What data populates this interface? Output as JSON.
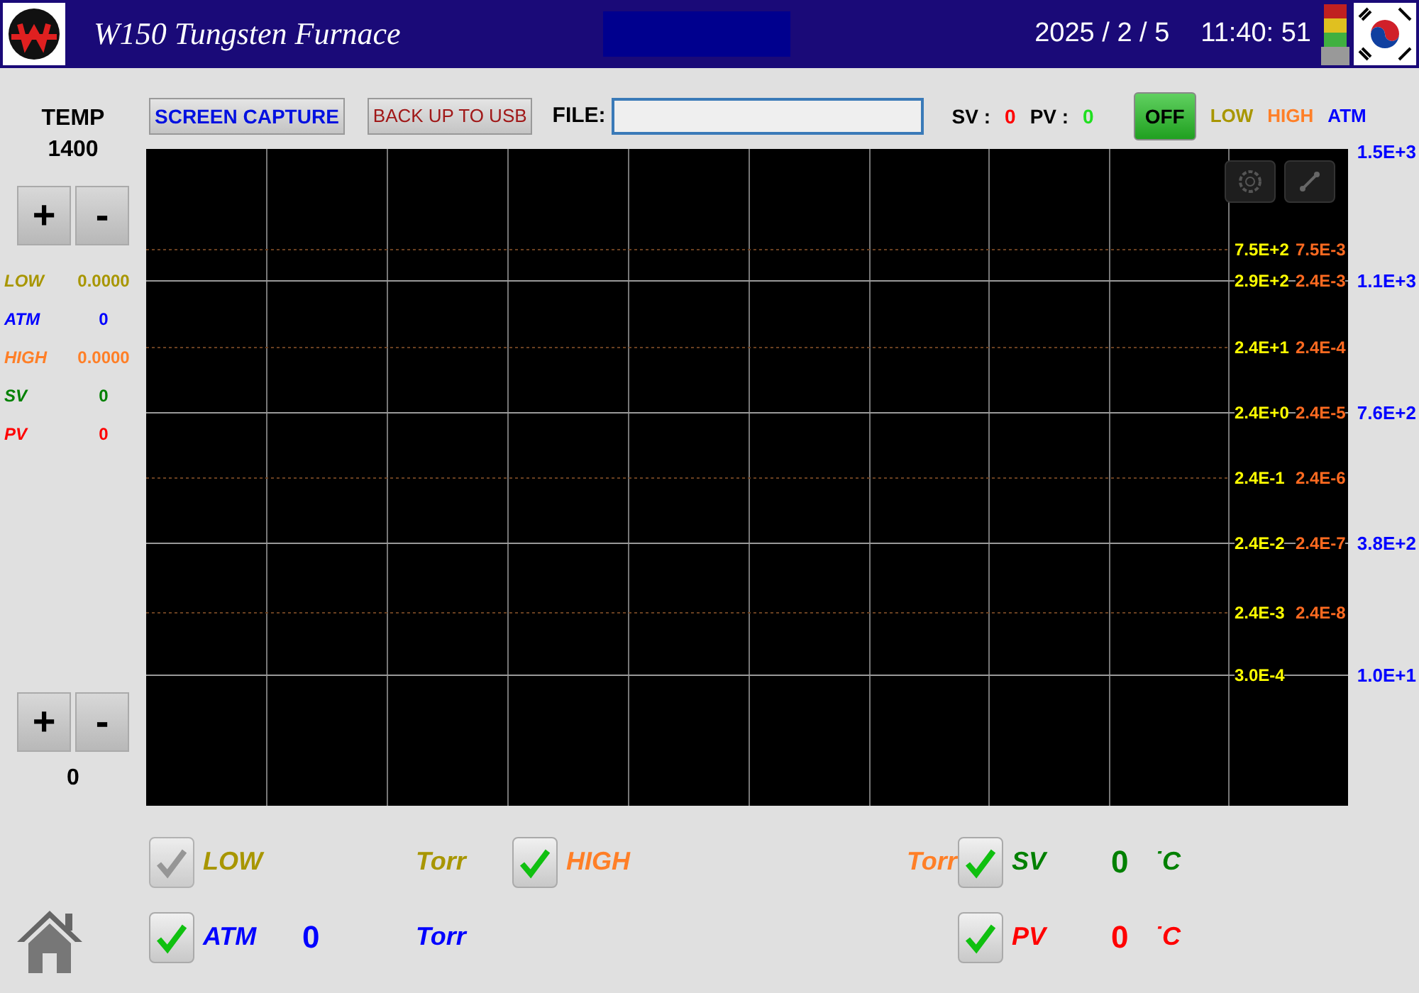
{
  "header": {
    "title": "W150 Tungsten Furnace",
    "date": "2025 / 2 / 5",
    "time": "11:40: 51"
  },
  "temp": {
    "label": "TEMP",
    "max_value": "1400",
    "min_value": "0",
    "max_buttons": [
      "+",
      "-"
    ],
    "min_buttons": [
      "+",
      "-"
    ]
  },
  "toolbar": {
    "screen_capture": "SCREEN CAPTURE",
    "backup": "BACK UP TO USB",
    "file_label": "FILE:",
    "sv_label": "SV :",
    "sv_value": "0",
    "pv_label": "PV :",
    "pv_value": "0",
    "power": {
      "label": "OFF",
      "on": false
    }
  },
  "readouts": [
    {
      "label": "LOW",
      "value": "0.0000",
      "color": "#a89600"
    },
    {
      "label": "ATM",
      "value": "0",
      "color": "#0000ff"
    },
    {
      "label": "HIGH",
      "value": "0.0000",
      "color": "#ff7f27"
    },
    {
      "label": "SV",
      "value": "0",
      "color": "#008000"
    },
    {
      "label": "PV",
      "value": "0",
      "color": "#ff0000"
    }
  ],
  "legend": [
    {
      "label": "LOW",
      "color": "#a89600"
    },
    {
      "label": "HIGH",
      "color": "#ff7f27"
    },
    {
      "label": "ATM",
      "color": "#0000ff"
    }
  ],
  "scale_rows": [
    {
      "low": "7.5E+2",
      "high": "7.5E-3"
    },
    {
      "low": "2.9E+2",
      "high": "2.4E-3"
    },
    {
      "low": "2.4E+1",
      "high": "2.4E-4"
    },
    {
      "low": "2.4E+0",
      "high": "2.4E-5"
    },
    {
      "low": "2.4E-1",
      "high": "2.4E-6"
    },
    {
      "low": "2.4E-2",
      "high": "2.4E-7"
    },
    {
      "low": "2.4E-3",
      "high": "2.4E-8"
    },
    {
      "low": "3.0E-4"
    }
  ],
  "atm_ticks": [
    "1.5E+3",
    "1.1E+3",
    "7.6E+2",
    "3.8E+2",
    "1.0E+1"
  ],
  "channel_columns": [
    [
      {
        "label": "LOW",
        "unit": "Torr",
        "color": "#a89600",
        "checked": true,
        "disabled": true
      },
      {
        "label": "ATM",
        "value": "0",
        "unit": "Torr",
        "color": "#0000ff",
        "checked": true,
        "disabled": false
      }
    ],
    [
      {
        "label": "HIGH",
        "unit": "Torr",
        "color": "#ff7f27",
        "checked": true,
        "disabled": false
      }
    ],
    [
      {
        "label": "SV",
        "value": "0",
        "unit": "˙C",
        "color": "#008000",
        "checked": true,
        "disabled": false
      },
      {
        "label": "PV",
        "value": "0",
        "unit": "˙C",
        "color": "#ff0000",
        "checked": true,
        "disabled": false
      }
    ]
  ]
}
